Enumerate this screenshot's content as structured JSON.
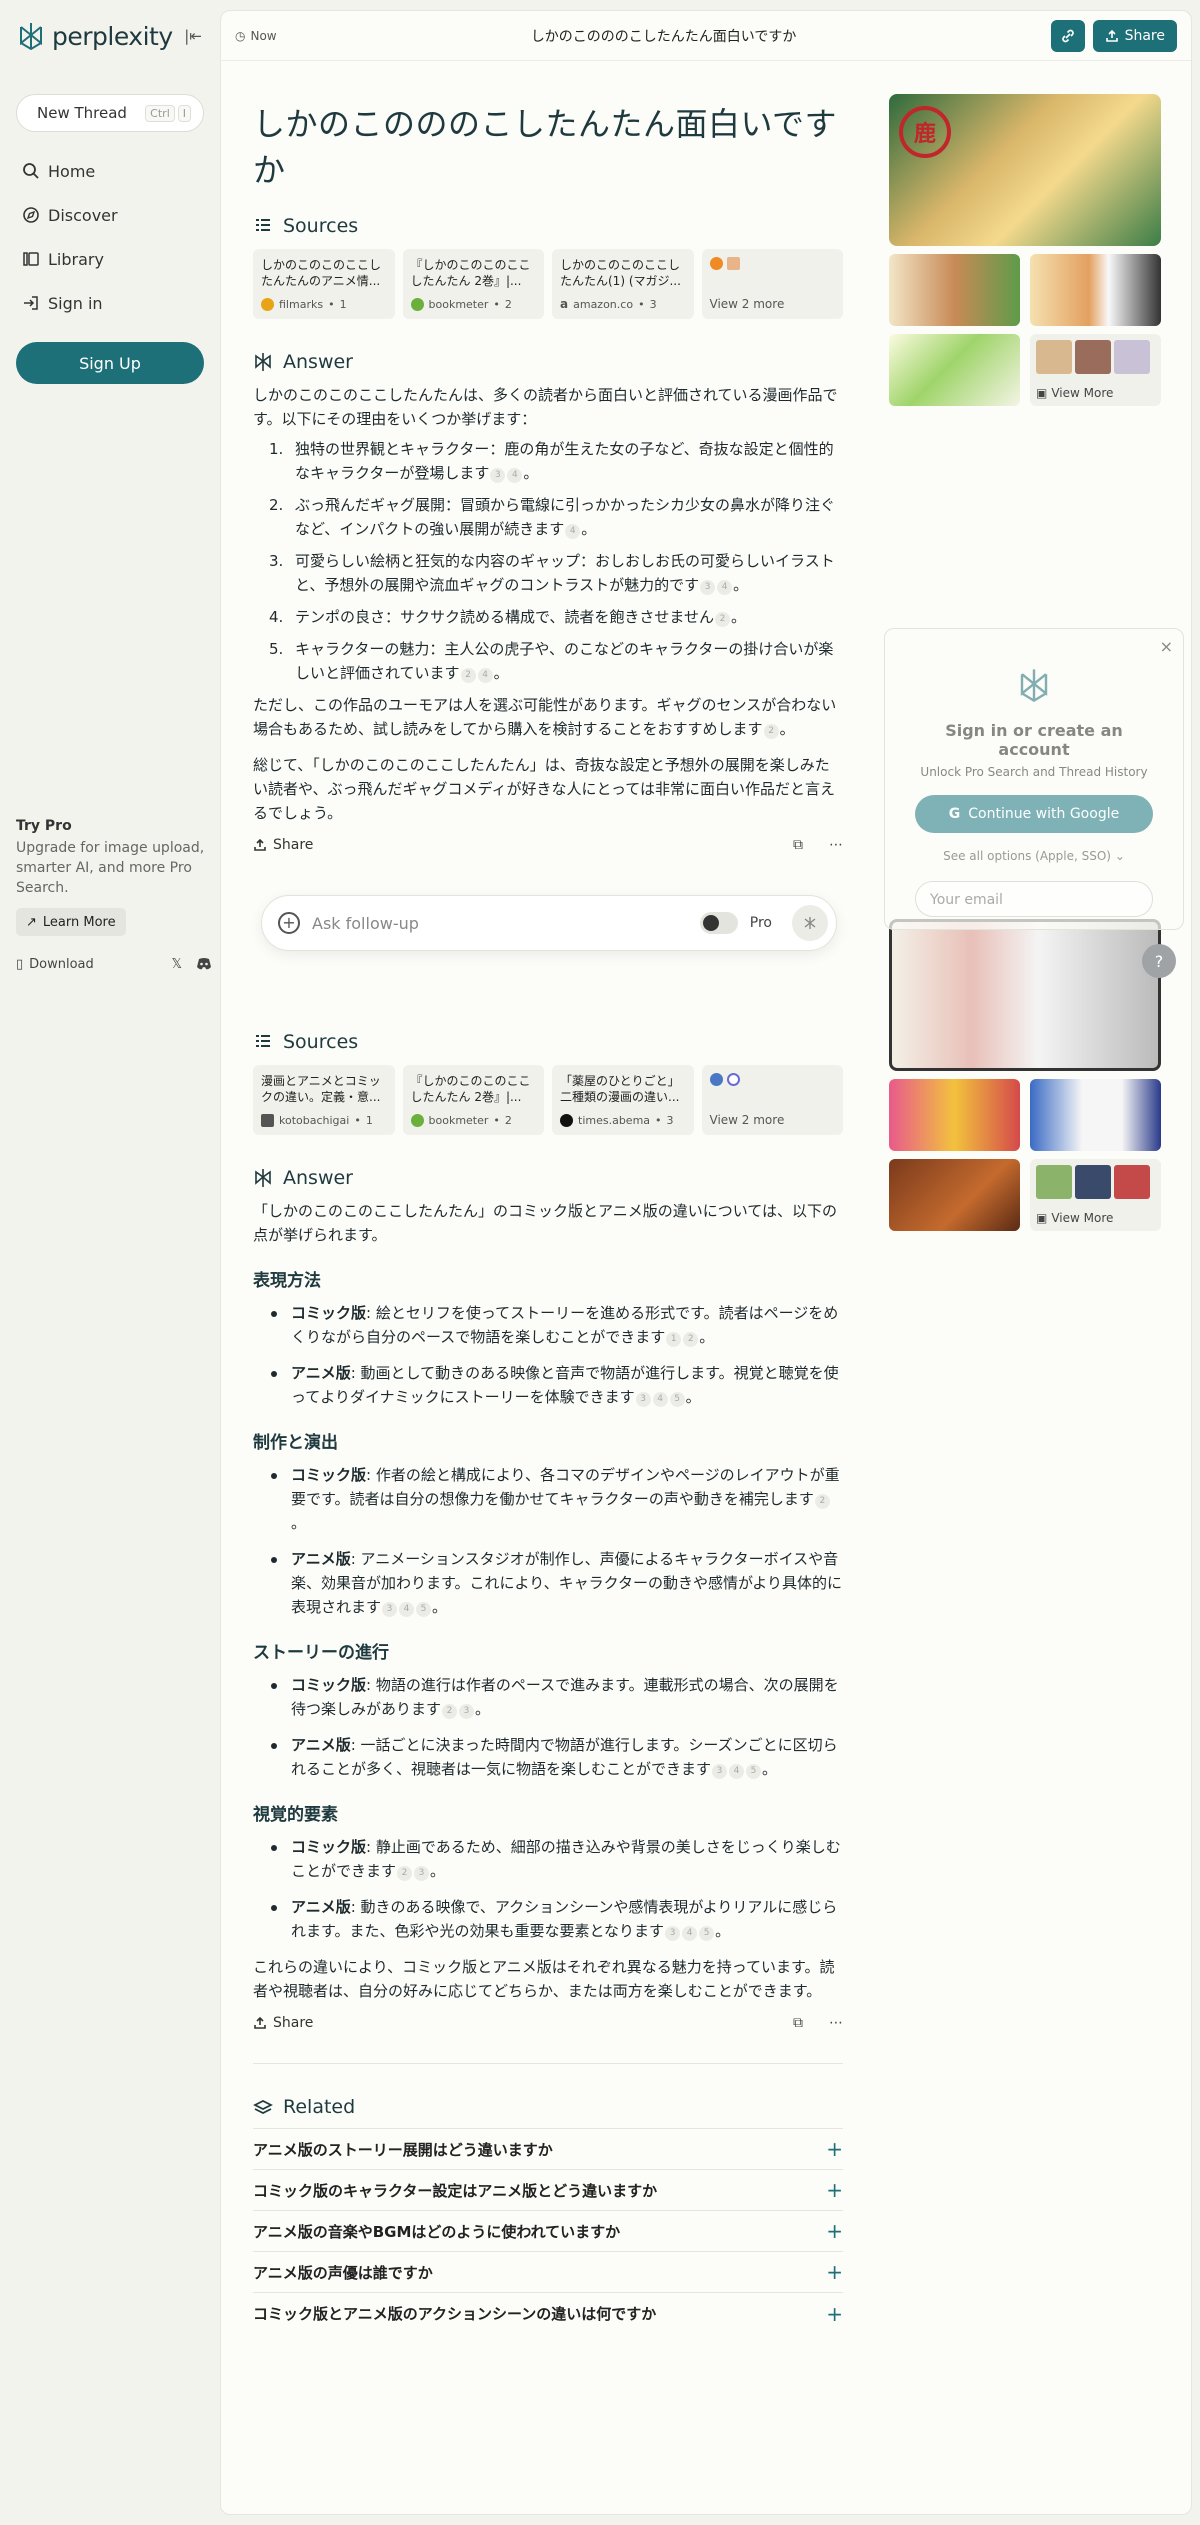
{
  "sidebar": {
    "brand": "perplexity",
    "new_thread": "New Thread",
    "kbd": [
      "Ctrl",
      "I"
    ],
    "nav": [
      {
        "label": "Home",
        "icon": "search-icon"
      },
      {
        "label": "Discover",
        "icon": "compass-icon"
      },
      {
        "label": "Library",
        "icon": "library-icon"
      },
      {
        "label": "Sign in",
        "icon": "sign-in-icon"
      }
    ],
    "signup": "Sign Up",
    "try_pro_title": "Try Pro",
    "try_pro_desc": "Upgrade for image upload, smarter AI, and more Pro Search.",
    "learn_more": "Learn More",
    "download": "Download"
  },
  "topbar": {
    "time": "Now",
    "title": "しかのこのののこしたんたん面白いですか",
    "share": "Share"
  },
  "thread1": {
    "question": "しかのこのののこしたんたん面白いですか",
    "sources_label": "Sources",
    "sources": [
      {
        "title": "しかのこのこのここしたんたんのアニメ情...",
        "site": "filmarks",
        "num": "1",
        "color": "#e8a317"
      },
      {
        "title": "『しかのこのこのここしたんたん 2巻』|...",
        "site": "bookmeter",
        "num": "2",
        "color": "#6bb03d"
      },
      {
        "title": "しかのこのこのここしたんたん(1) (マガジ...",
        "site": "amazon.co",
        "num": "3",
        "color": "#222222"
      }
    ],
    "view_more": "View 2 more",
    "answer_label": "Answer",
    "intro": "しかのこのこのここしたんたんは、多くの読者から面白いと評価されている漫画作品です。以下にその理由をいくつか挙げます：",
    "points": [
      {
        "n": "1.",
        "text": "独特の世界観とキャラクター：鹿の角が生えた女の子など、奇抜な設定と個性的なキャラクターが登場します",
        "cites": [
          "3",
          "4"
        ]
      },
      {
        "n": "2.",
        "text": "ぶっ飛んだギャグ展開：冒頭から電線に引っかかったシカ少女の鼻水が降り注ぐなど、インパクトの強い展開が続きます",
        "cites": [
          "4"
        ]
      },
      {
        "n": "3.",
        "text": "可愛らしい絵柄と狂気的な内容のギャップ：おしおしお氏の可愛らしいイラストと、予想外の展開や流血ギャグのコントラストが魅力的です",
        "cites": [
          "3",
          "4"
        ]
      },
      {
        "n": "4.",
        "text": "テンポの良さ：サクサク読める構成で、読者を飽きさせません",
        "cites": [
          "2"
        ]
      },
      {
        "n": "5.",
        "text": "キャラクターの魅力：主人公の虎子や、のこなどのキャラクターの掛け合いが楽しいと評価されています",
        "cites": [
          "2",
          "4"
        ]
      }
    ],
    "caveat": "ただし、この作品のユーモアは人を選ぶ可能性があります。ギャグのセンスが合わない場合もあるため、試し読みをしてから購入を検討することをおすすめします",
    "caveat_cite": "2",
    "conclusion": "総じて、「しかのこのこのここしたんたん」は、奇抜な設定と予想外の展開を楽しみたい読者や、ぶっ飛んだギャグコメディが好きな人にとっては非常に面白い作品だと言えるでしょう。",
    "share": "Share"
  },
  "followup": {
    "placeholder": "Ask follow-up",
    "pro": "Pro"
  },
  "thread2": {
    "sources_label": "Sources",
    "sources": [
      {
        "title": "漫画とアニメとコミックの違い。定義・意...",
        "site": "kotobachigai",
        "num": "1",
        "color": "#555555"
      },
      {
        "title": "『しかのこのこのここしたんたん 2巻』|...",
        "site": "bookmeter",
        "num": "2",
        "color": "#6bb03d"
      },
      {
        "title": "「薬屋のひとりごと」二種類の漫画の違い...",
        "site": "times.abema",
        "num": "3",
        "color": "#111111"
      }
    ],
    "view_more": "View 2 more",
    "answer_label": "Answer",
    "intro": "「しかのこのこのここしたんたん」のコミック版とアニメ版の違いについては、以下の点が挙げられます。",
    "sections": [
      {
        "heading": "表現方法",
        "items": [
          {
            "label": "コミック版",
            "text": ": 絵とセリフを使ってストーリーを進める形式です。読者はページをめくりながら自分のペースで物語を楽しむことができます",
            "cites": [
              "1",
              "2"
            ]
          },
          {
            "label": "アニメ版",
            "text": ": 動画として動きのある映像と音声で物語が進行します。視覚と聴覚を使ってよりダイナミックにストーリーを体験できます",
            "cites": [
              "3",
              "4",
              "5"
            ]
          }
        ]
      },
      {
        "heading": "制作と演出",
        "items": [
          {
            "label": "コミック版",
            "text": ": 作者の絵と構成により、各コマのデザインやページのレイアウトが重要です。読者は自分の想像力を働かせてキャラクターの声や動きを補完します",
            "cites": [
              "2"
            ]
          },
          {
            "label": "アニメ版",
            "text": ": アニメーションスタジオが制作し、声優によるキャラクターボイスや音楽、効果音が加わります。これにより、キャラクターの動きや感情がより具体的に表現されます",
            "cites": [
              "3",
              "4",
              "5"
            ]
          }
        ]
      },
      {
        "heading": "ストーリーの進行",
        "items": [
          {
            "label": "コミック版",
            "text": ": 物語の進行は作者のペースで進みます。連載形式の場合、次の展開を待つ楽しみがあります",
            "cites": [
              "2",
              "3"
            ]
          },
          {
            "label": "アニメ版",
            "text": ": 一話ごとに決まった時間内で物語が進行します。シーズンごとに区切られることが多く、視聴者は一気に物語を楽しむことができます",
            "cites": [
              "3",
              "4",
              "5"
            ]
          }
        ]
      },
      {
        "heading": "視覚的要素",
        "items": [
          {
            "label": "コミック版",
            "text": ": 静止画であるため、細部の描き込みや背景の美しさをじっくり楽しむことができます",
            "cites": [
              "2",
              "3"
            ]
          },
          {
            "label": "アニメ版",
            "text": ": 動きのある映像で、アクションシーンや感情表現がよりリアルに感じられます。また、色彩や光の効果も重要な要素となります",
            "cites": [
              "3",
              "4",
              "5"
            ]
          }
        ]
      }
    ],
    "conclusion": "これらの違いにより、コミック版とアニメ版はそれぞれ異なる魅力を持っています。読者や視聴者は、自分の好みに応じてどちらか、または両方を楽しむことができます。",
    "share": "Share"
  },
  "related": {
    "label": "Related",
    "items": [
      "アニメ版のストーリー展開はどう違いますか",
      "コミック版のキャラクター設定はアニメ版とどう違いますか",
      "アニメ版の音楽やBGMはどのように使われていますか",
      "アニメ版の声優は誰ですか",
      "コミック版とアニメ版のアクションシーンの違いは何ですか"
    ]
  },
  "images": {
    "view_more": "View More"
  },
  "signin": {
    "title": "Sign in or create an account",
    "subtitle": "Unlock Pro Search and Thread History",
    "google": "Continue with Google",
    "all_options": "See all options (Apple, SSO)",
    "email_placeholder": "Your email"
  },
  "colors": {
    "accent": "#1d6f78",
    "background": "#f3f3ee",
    "panel": "#fcfcf8"
  }
}
